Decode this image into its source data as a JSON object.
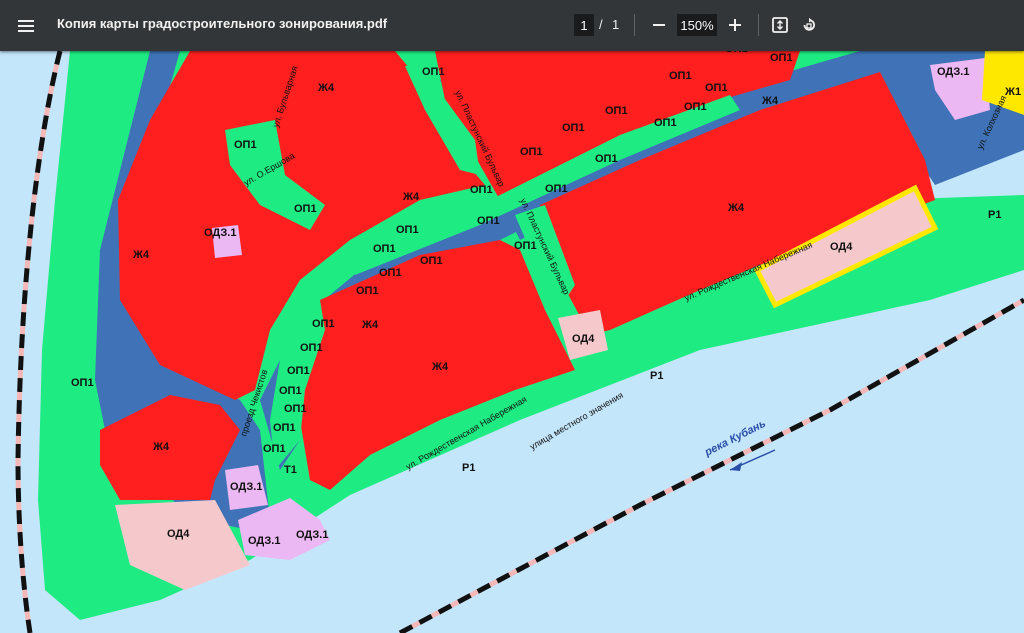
{
  "toolbar": {
    "menu_icon": "hamburger-menu-icon",
    "title": "Копия карты градостроительного зонирования.pdf",
    "page_current": "1",
    "page_sep": "/",
    "page_total": "1",
    "zoom": "150%",
    "zoom_out_icon": "minus-icon",
    "zoom_in_icon": "plus-icon",
    "fit_icon": "fit-page-icon",
    "rotate_icon": "rotate-icon"
  },
  "colors": {
    "residential": "#ff1f1f",
    "green": "#1eec82",
    "road": "#3f72b6",
    "od31": "#ecb8f3",
    "od4": "#f5c9cc",
    "water": "#c4e6fb",
    "yellow": "#ffe800"
  },
  "map": {
    "labels": {
      "op1": "ОП1",
      "zh4": "Ж4",
      "od31": "ОДЗ.1",
      "od4": "ОД4",
      "t1": "Т1",
      "r1": "Р1",
      "zh1": "Ж1"
    },
    "streets": {
      "bulvarnaya": "ул. Бульварная",
      "ershova": "ул. О.Ершова",
      "plastunsky": "ул. Пластунский Бульвар",
      "rozhd_naber": "ул. Рождественская Набережная",
      "chekistov": "проезд Чекистов",
      "mestnogo": "улица местного значения",
      "kuban_river": "река Кубань",
      "kolhoznaya": "ул. Колхозная"
    }
  }
}
